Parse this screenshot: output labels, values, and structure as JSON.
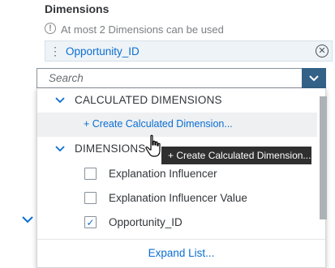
{
  "header": {
    "title": "Dimensions",
    "info_text": "At most 2 Dimensions can be used"
  },
  "chip": {
    "label": "Opportunity_ID"
  },
  "search": {
    "placeholder": "Search"
  },
  "dropdown": {
    "calculated_group": "CALCULATED DIMENSIONS",
    "create_link": "+ Create Calculated Dimension...",
    "dimensions_group": "DIMENSIONS",
    "items": [
      {
        "label": "Explanation Influencer",
        "checked": false
      },
      {
        "label": "Explanation Influencer Value",
        "checked": false
      },
      {
        "label": "Opportunity_ID",
        "checked": true
      }
    ],
    "expand_label": "Expand List..."
  },
  "tooltip": {
    "text": "+ Create Calculated Dimension..."
  },
  "colors": {
    "accent": "#0a6ed1",
    "search_button": "#346187",
    "tooltip_bg": "#2f2f2f"
  },
  "icons": {
    "info": "exclamation-circle-icon",
    "grip": "vertical-grip-icon",
    "remove": "close-circle-icon",
    "dropdown": "chevron-down-icon",
    "check": "checkmark-icon",
    "cursor": "hand-pointer-icon"
  }
}
